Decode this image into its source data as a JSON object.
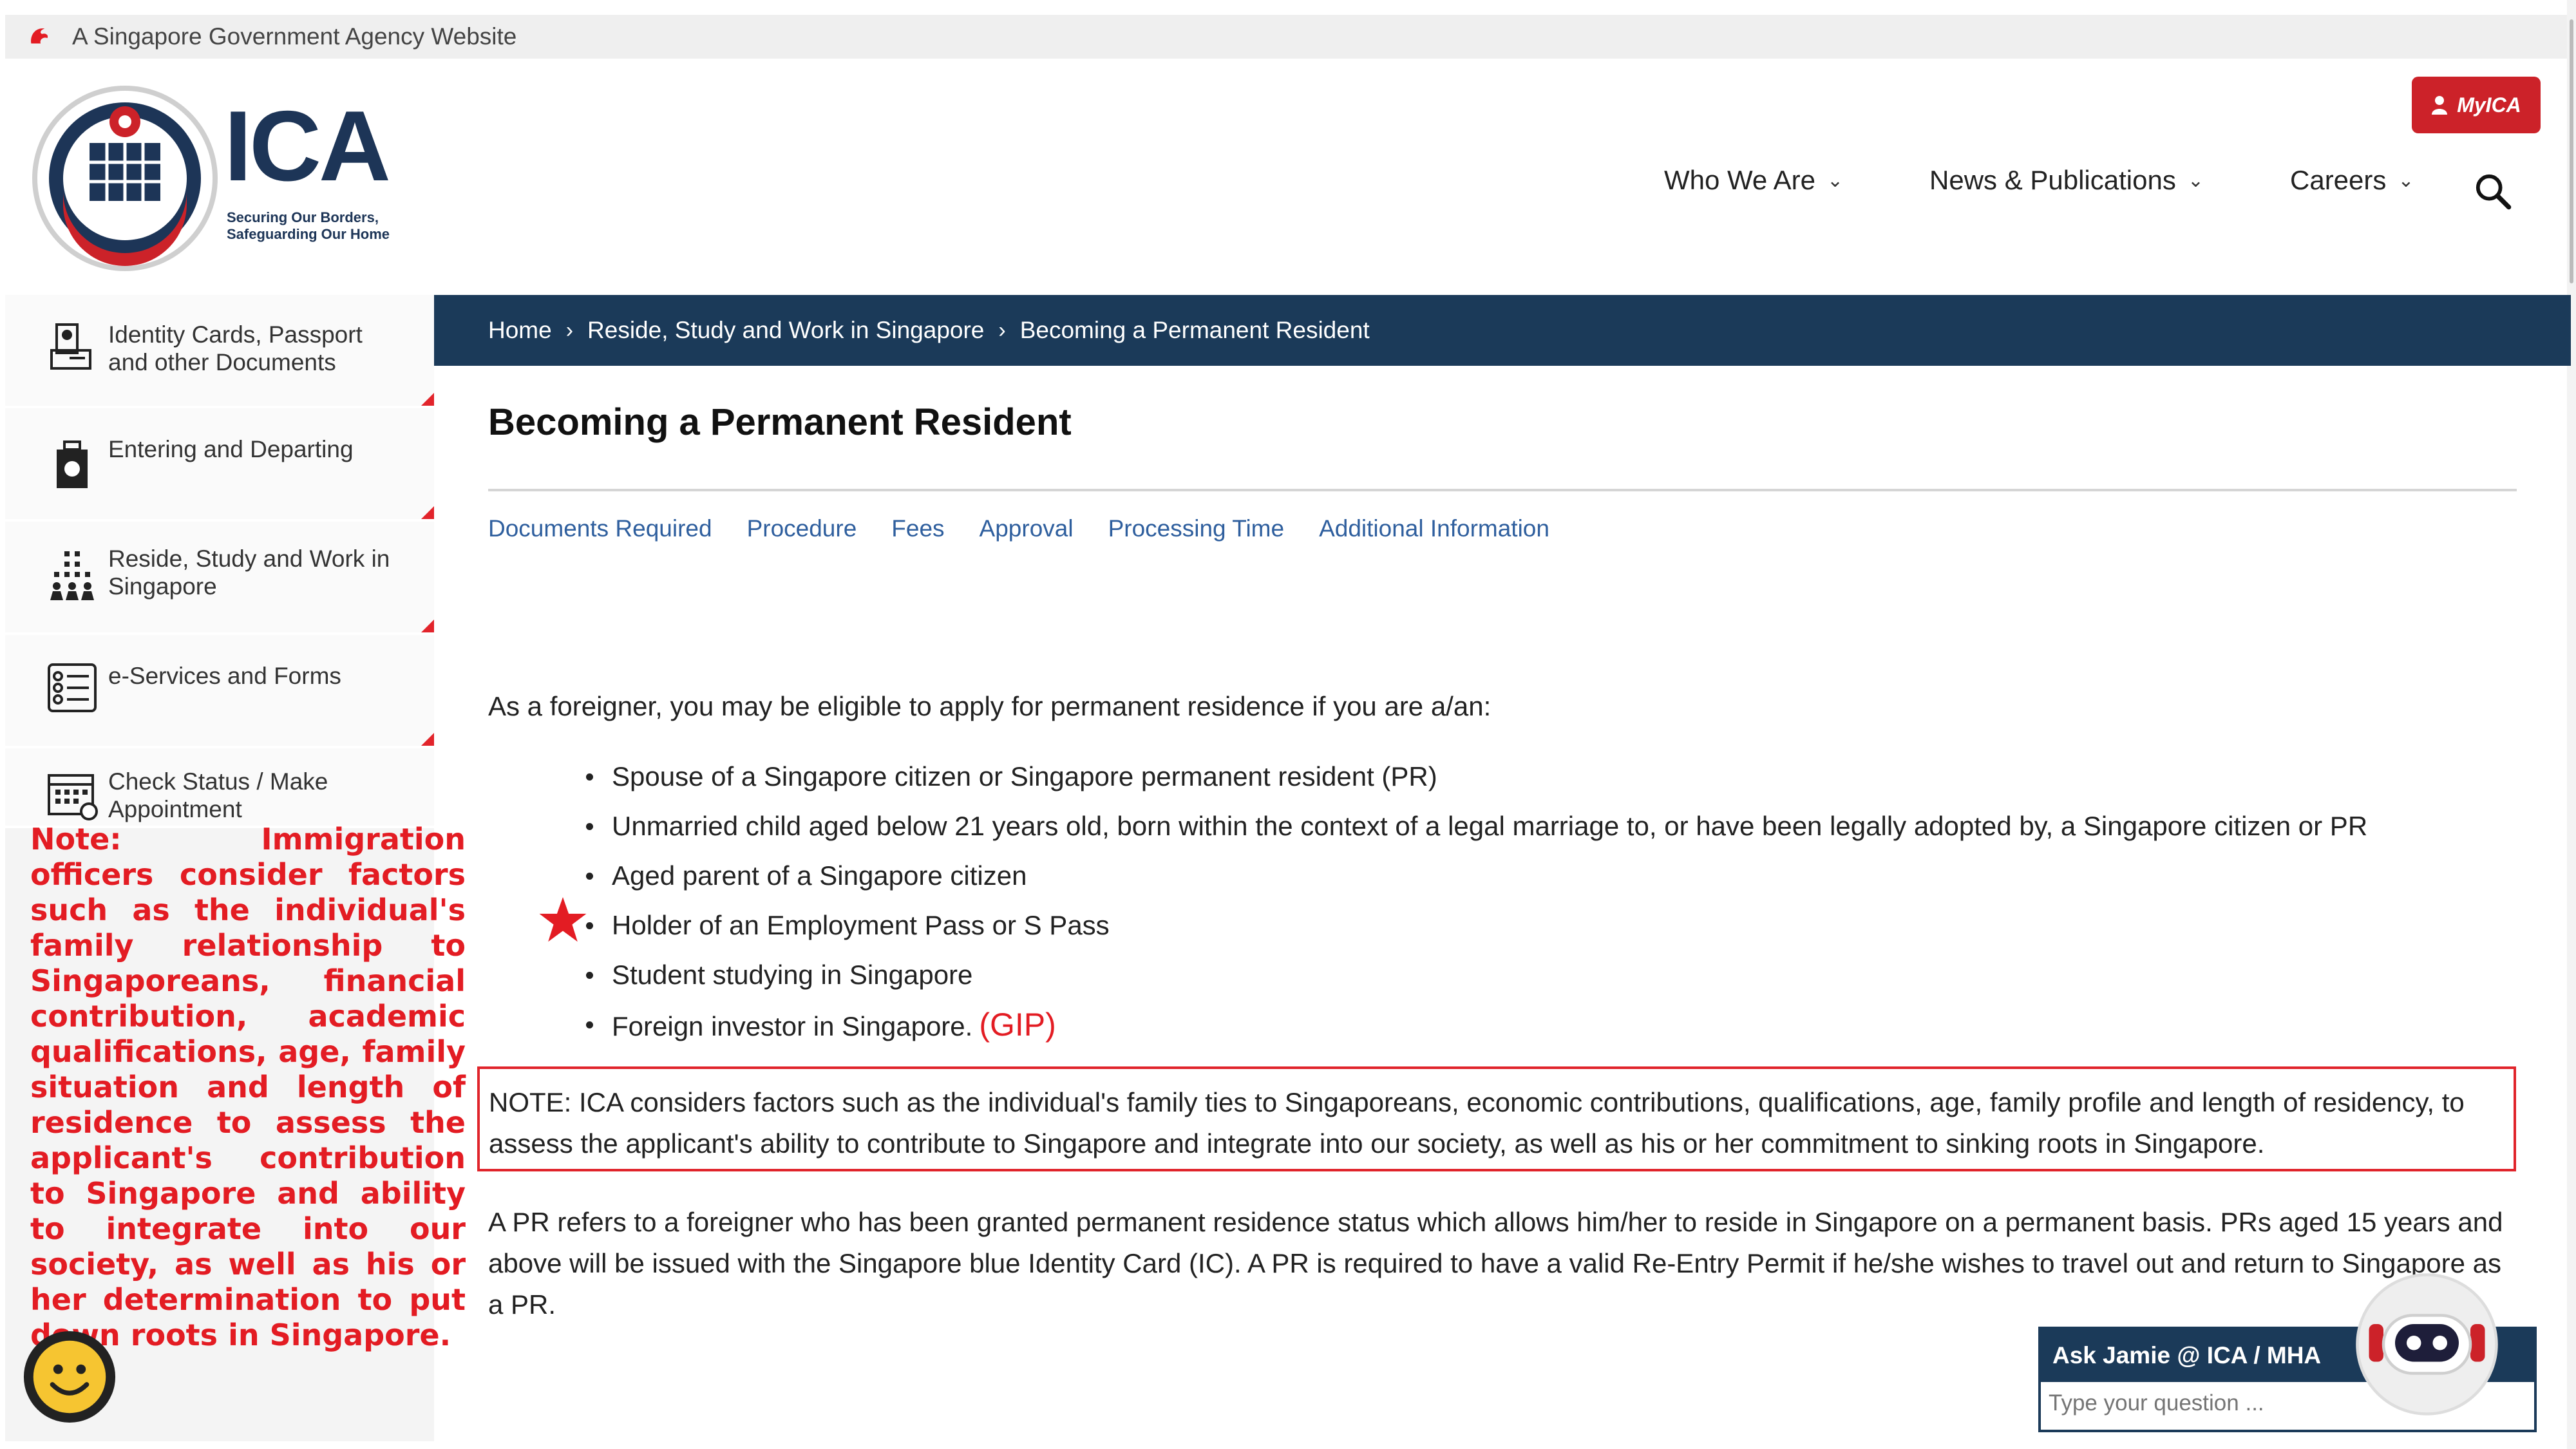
{
  "topbar": {
    "text": "A Singapore Government Agency Website"
  },
  "logo": {
    "name": "ICA",
    "tagline_1": "Securing Our Borders,",
    "tagline_2": "Safeguarding Our Home"
  },
  "myica_button": "MyICA",
  "nav": {
    "items": [
      {
        "label": "Who We Are"
      },
      {
        "label": "News & Publications"
      },
      {
        "label": "Careers"
      }
    ]
  },
  "sidebar": {
    "items": [
      {
        "label": "Identity Cards, Passport and other Documents",
        "icon": "id-card-icon"
      },
      {
        "label": "Entering and Departing",
        "icon": "luggage-icon"
      },
      {
        "label": "Reside, Study and Work in Singapore",
        "icon": "building-people-icon"
      },
      {
        "label": "e-Services and Forms",
        "icon": "checklist-icon"
      },
      {
        "label": "Check Status / Make Appointment",
        "icon": "calendar-icon"
      }
    ]
  },
  "side_note": "Note: Immigration officers consider factors such as the individual's family relationship to Singaporeans, financial contribution, academic qualifications, age, family situation and length of residence to assess the applicant's contribution to Singapore and ability to integrate into our society, as well as his or her determination to put down roots in Singapore.",
  "breadcrumb": {
    "items": [
      "Home",
      "Reside, Study and Work in Singapore",
      "Becoming a Permanent Resident"
    ]
  },
  "page_title": "Becoming a Permanent Resident",
  "tabs": [
    "Documents Required",
    "Procedure",
    "Fees",
    "Approval",
    "Processing Time",
    "Additional Information"
  ],
  "intro": "As a foreigner, you may be eligible to apply for permanent residence if you are a/an:",
  "eligibility": [
    "Spouse of a Singapore citizen or Singapore permanent resident (PR)",
    "Unmarried child aged below 21 years old, born within the context of a legal marriage to, or have been legally adopted by, a Singapore citizen or PR",
    "Aged parent of a Singapore citizen",
    "Holder of an Employment Pass or S Pass",
    "Student studying in Singapore",
    "Foreign investor in Singapore."
  ],
  "gip_annotation": "(GIP)",
  "note_box": "NOTE: ICA considers factors such as the individual's family ties to Singaporeans, economic contributions, qualifications, age, family profile and length of residency, to assess the applicant's ability to contribute to Singapore and integrate into our society, as well as his or her commitment to sinking roots in Singapore.",
  "pr_paragraph": "A PR refers to a foreigner who has been granted permanent residence status which allows him/her to reside in Singapore on a permanent basis.  PRs aged 15 years and above will be issued with the Singapore blue Identity Card (IC). A PR is required to have a valid Re-Entry Permit if he/she wishes to travel out and return to Singapore as a PR.",
  "chat": {
    "title": "Ask Jamie @ ICA / MHA",
    "placeholder": "Type your question ..."
  },
  "colors": {
    "brand_navy": "#1b3a59",
    "accent_red": "#e31c23",
    "link_blue": "#2f5f9e"
  }
}
